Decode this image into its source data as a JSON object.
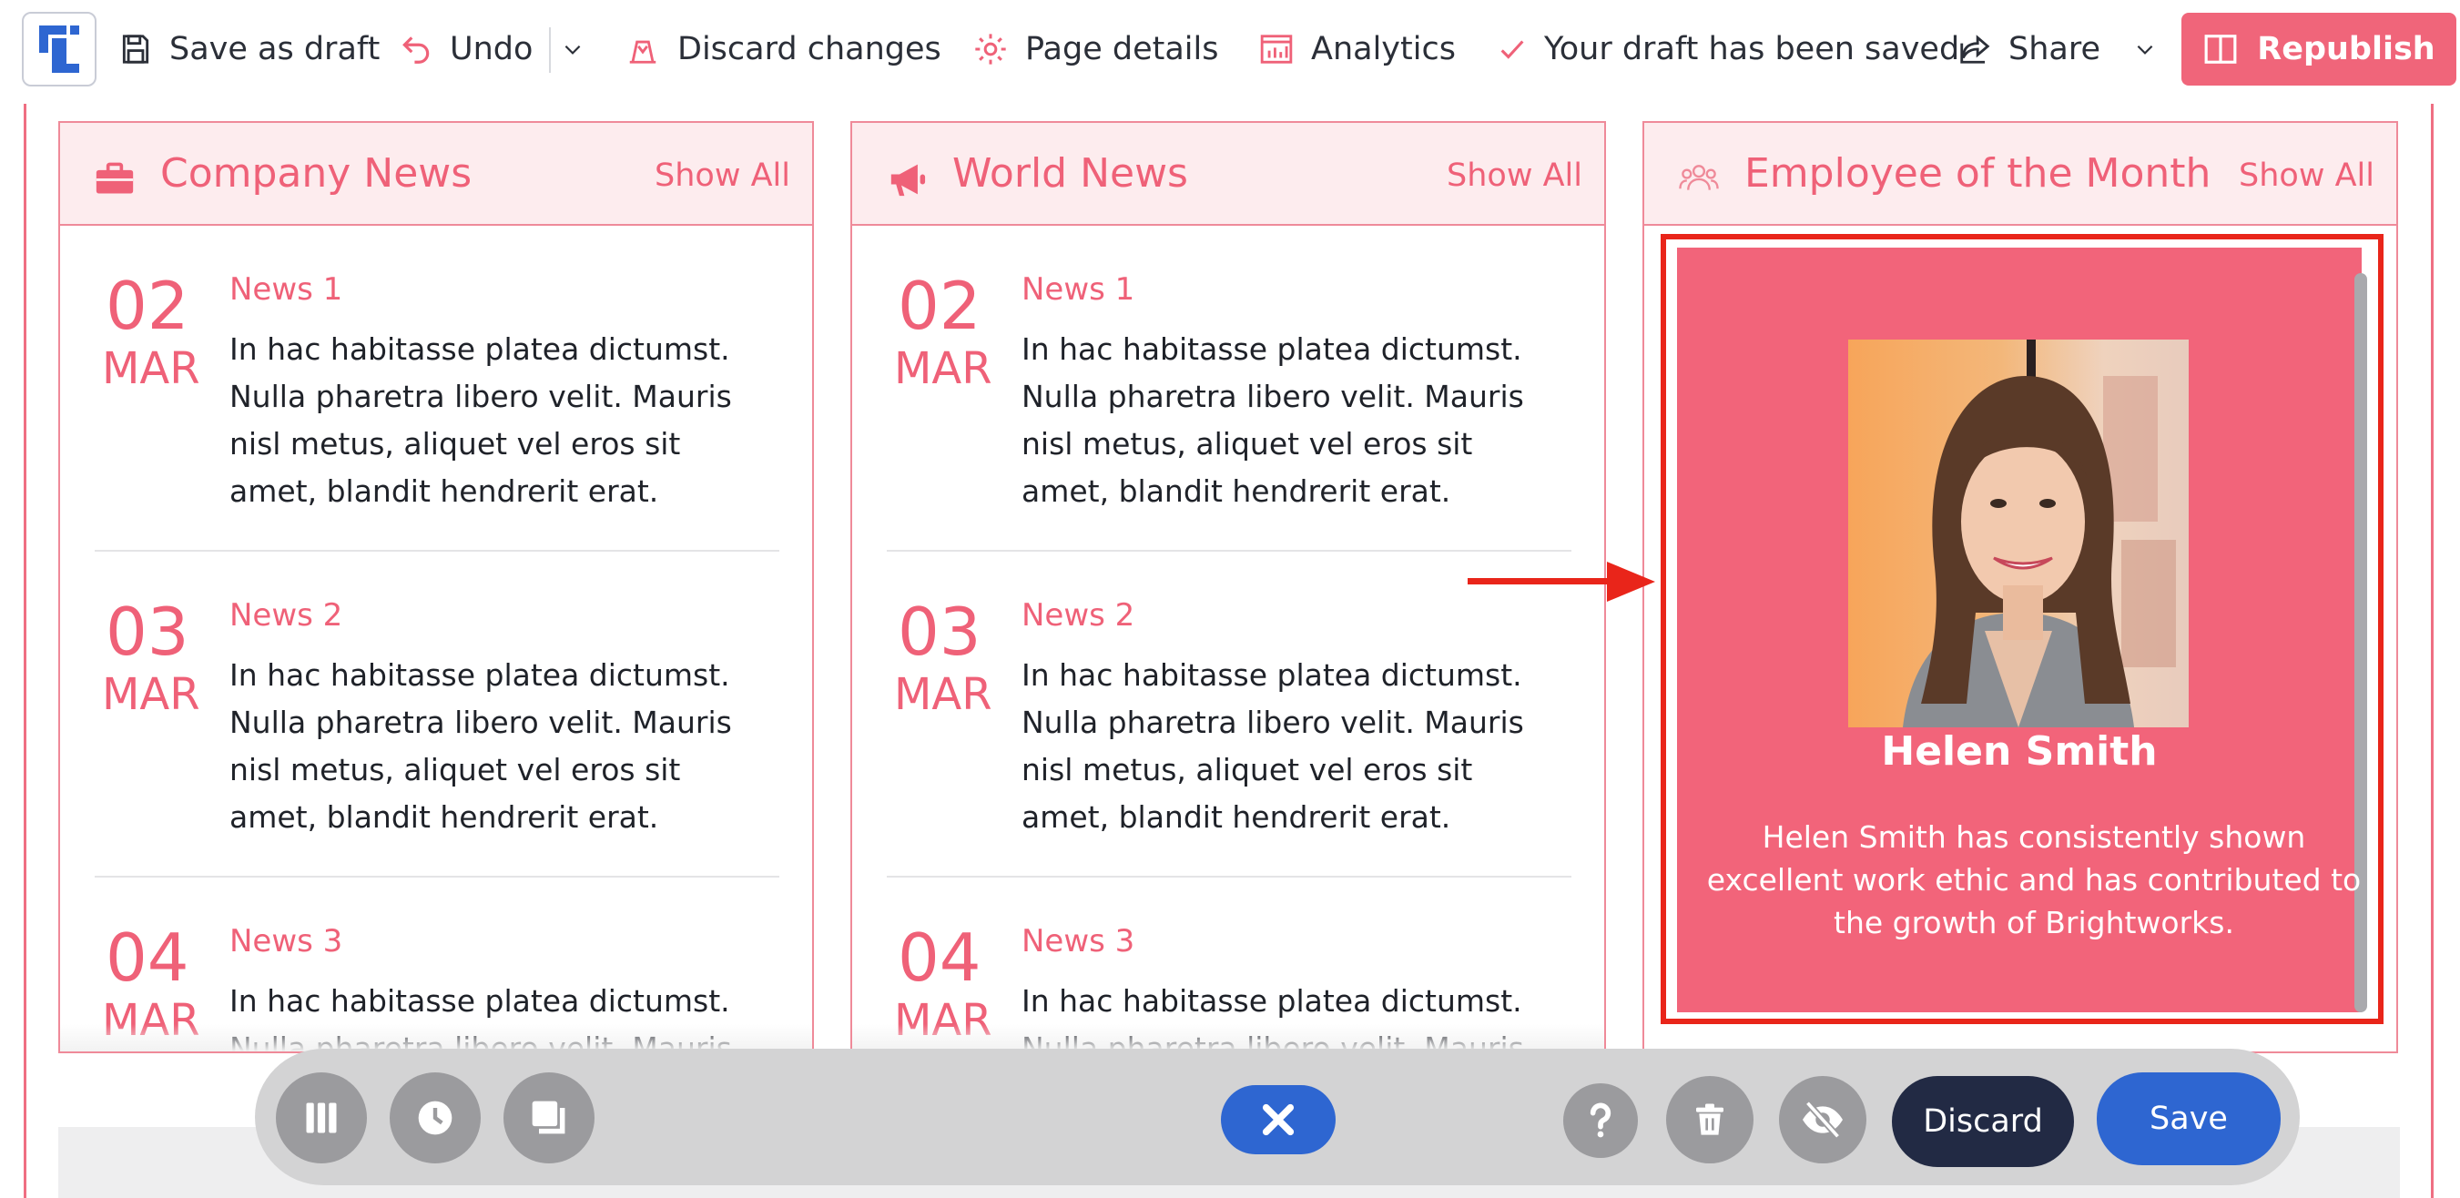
{
  "toolbar": {
    "save_draft": "Save as draft",
    "undo": "Undo",
    "discard_changes": "Discard changes",
    "page_details": "Page details",
    "analytics": "Analytics",
    "draft_status": "Your draft has been saved",
    "share": "Share",
    "republish": "Republish"
  },
  "columns": [
    {
      "title": "Company News",
      "show_all": "Show All",
      "items": [
        {
          "day": "02",
          "month": "MAR",
          "title": "News 1",
          "body": "In hac habitasse platea dictumst. Nulla pharetra libero velit. Mauris nisl metus, aliquet vel eros sit amet, blandit hendrerit erat."
        },
        {
          "day": "03",
          "month": "MAR",
          "title": "News 2",
          "body": "In hac habitasse platea dictumst. Nulla pharetra libero velit. Mauris nisl metus, aliquet vel eros sit amet, blandit hendrerit erat."
        },
        {
          "day": "04",
          "month": "MAR",
          "title": "News 3",
          "body": "In hac habitasse platea dictumst. Nulla pharetra libero velit. Mauris nisl metus, aliquet vel eros sit amet, blandit hendrerit erat."
        }
      ]
    },
    {
      "title": "World News",
      "show_all": "Show All",
      "items": [
        {
          "day": "02",
          "month": "MAR",
          "title": "News 1",
          "body": "In hac habitasse platea dictumst. Nulla pharetra libero velit. Mauris nisl metus, aliquet vel eros sit amet, blandit hendrerit erat."
        },
        {
          "day": "03",
          "month": "MAR",
          "title": "News 2",
          "body": "In hac habitasse platea dictumst. Nulla pharetra libero velit. Mauris nisl metus, aliquet vel eros sit amet, blandit hendrerit erat."
        },
        {
          "day": "04",
          "month": "MAR",
          "title": "News 3",
          "body": "In hac habitasse platea dictumst. Nulla pharetra libero velit. Mauris nisl metus, aliquet vel eros sit amet, blandit hendrerit erat."
        }
      ]
    }
  ],
  "employee": {
    "title": "Employee of the Month",
    "show_all": "Show All",
    "name": "Helen Smith",
    "description": "Helen Smith has consistently shown excellent work ethic and has contributed to the growth of Brightworks."
  },
  "editbar": {
    "discard": "Discard",
    "save": "Save"
  },
  "colors": {
    "accent": "#f0657a",
    "header_bg": "#fdecee",
    "primary_button": "#2e66d1",
    "dark_button": "#222a44",
    "selection_outline": "#e9251a"
  },
  "icons": [
    "app-logo-icon",
    "save-icon",
    "undo-icon",
    "chevron-down-icon",
    "discard-icon",
    "gear-icon",
    "analytics-icon",
    "check-icon",
    "share-icon",
    "book-icon",
    "briefcase-icon",
    "megaphone-icon",
    "people-icon",
    "columns-icon",
    "clock-icon",
    "layers-icon",
    "close-icon",
    "help-icon",
    "trash-icon",
    "eye-off-icon"
  ]
}
